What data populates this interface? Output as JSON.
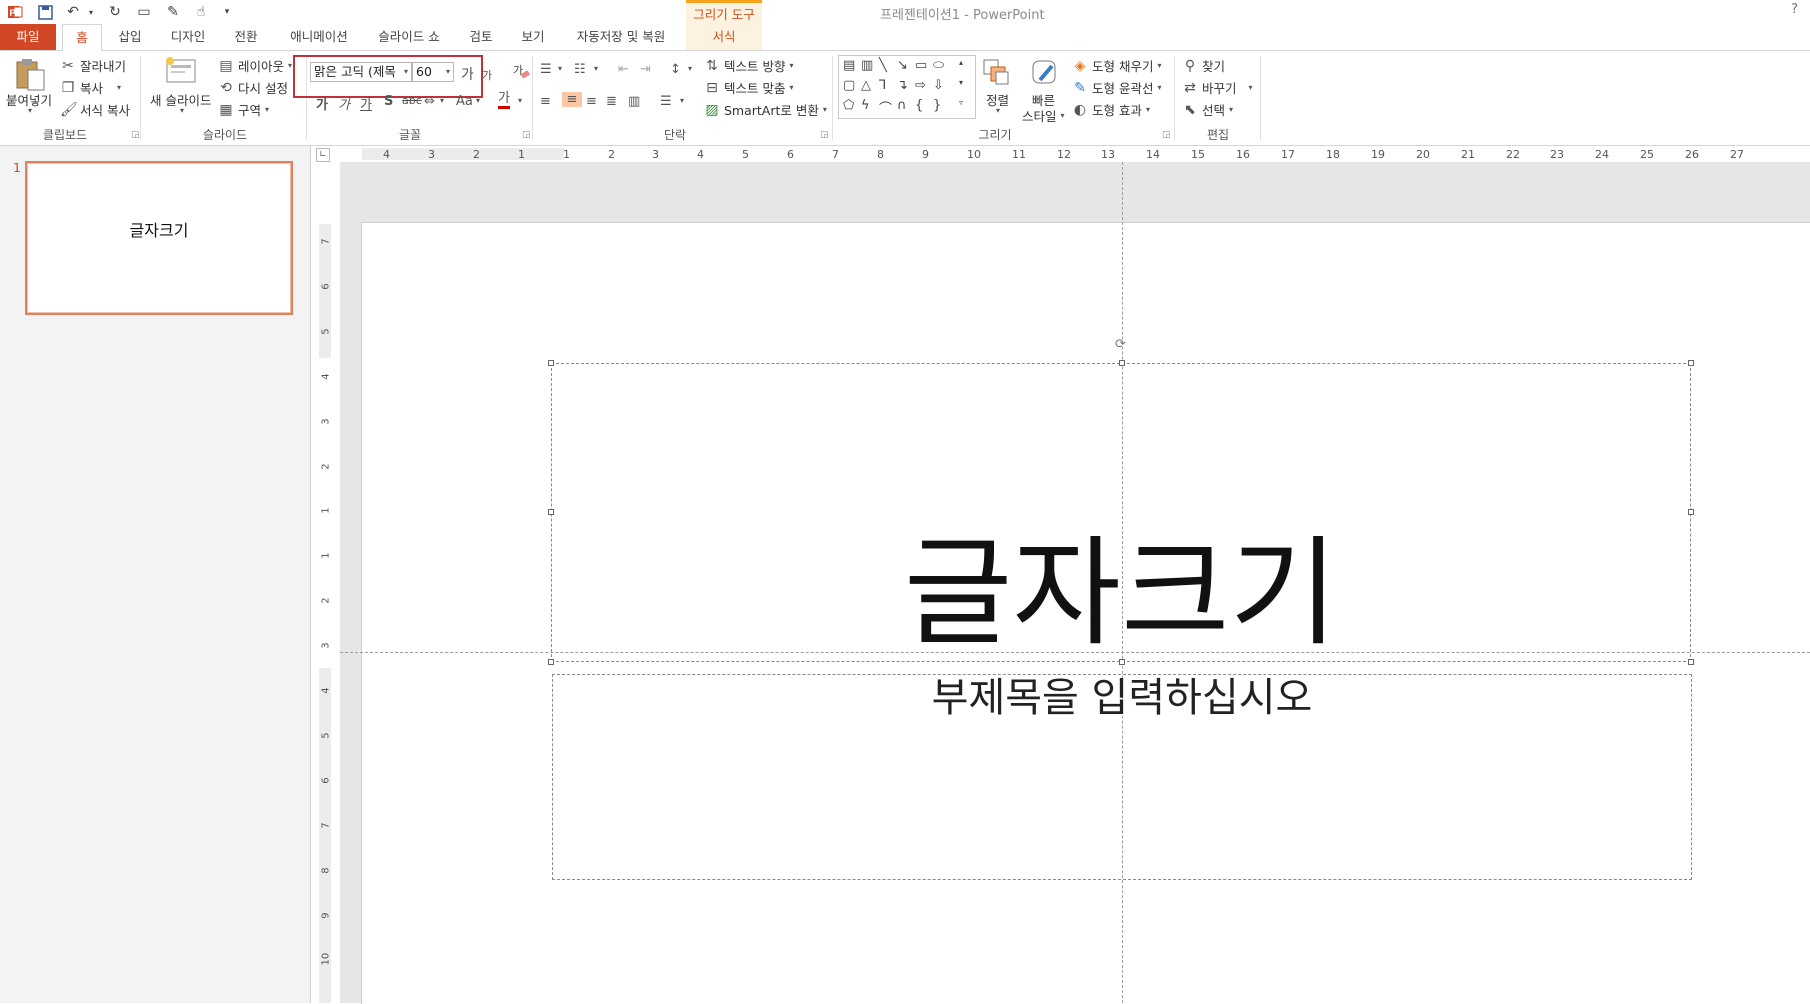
{
  "app": {
    "window_title": "프레젠테이션1 - PowerPoint",
    "help": "?"
  },
  "qat": {
    "icons": [
      "powerpoint-logo-icon",
      "save-icon",
      "undo-icon",
      "redo-icon",
      "presentation-icon",
      "draw-icon",
      "touch-mode-icon",
      "customize-icon"
    ]
  },
  "tabs": {
    "file": "파일",
    "home": "홈",
    "insert": "삽입",
    "design": "디자인",
    "transitions": "전환",
    "animations": "애니메이션",
    "slideshow": "슬라이드 쇼",
    "review": "검토",
    "view": "보기",
    "autosave": "자동저장 및 복원",
    "context_label": "그리기 도구",
    "format": "서식"
  },
  "ribbon": {
    "clipboard": {
      "paste": "붙여넣기",
      "cut": "잘라내기",
      "copy": "복사",
      "format_painter": "서식 복사",
      "label": "클립보드"
    },
    "slides": {
      "new_slide": "새 슬라이드",
      "layout": "레이아웃",
      "reset": "다시 설정",
      "section": "구역",
      "label": "슬라이드"
    },
    "font": {
      "font_name": "맑은 고딕 (제목",
      "font_size": "60",
      "grow_label": "가",
      "shrink_label": "가",
      "font_color_label": "가",
      "change_case": "Aa",
      "label": "글꼴"
    },
    "paragraph": {
      "text_direction": "텍스트 방향",
      "align_text": "텍스트 맞춤",
      "smartart": "SmartArt로 변환",
      "label": "단락"
    },
    "drawing": {
      "arrange": "정렬",
      "quick_styles_1": "빠른",
      "quick_styles_2": "스타일",
      "shape_fill": "도형 채우기",
      "shape_outline": "도형 윤곽선",
      "shape_effects": "도형 효과",
      "label": "그리기"
    },
    "editing": {
      "find": "찾기",
      "replace": "바꾸기",
      "select": "선택",
      "label": "편집"
    }
  },
  "thumbnails": [
    {
      "number": "1",
      "title": "글자크기"
    }
  ],
  "slide": {
    "title": "글자크기",
    "subtitle": "부제목을 입력하십시오"
  },
  "rulers": {
    "horizontal": [
      "4",
      "3",
      "2",
      "1",
      "1",
      "2",
      "3",
      "4",
      "5",
      "6",
      "7",
      "8",
      "9",
      "10",
      "11",
      "12",
      "13",
      "14",
      "15",
      "16",
      "17",
      "18",
      "19",
      "20",
      "21",
      "22",
      "23",
      "24",
      "25",
      "26",
      "27"
    ],
    "vertical": [
      "7",
      "6",
      "5",
      "4",
      "3",
      "2",
      "1",
      "1",
      "2",
      "3",
      "4",
      "5",
      "6",
      "7",
      "8",
      "9",
      "10"
    ]
  },
  "colors": {
    "accent": "#d24726",
    "highlight_box": "#c0313b",
    "context_tab": "#f7a21b"
  }
}
